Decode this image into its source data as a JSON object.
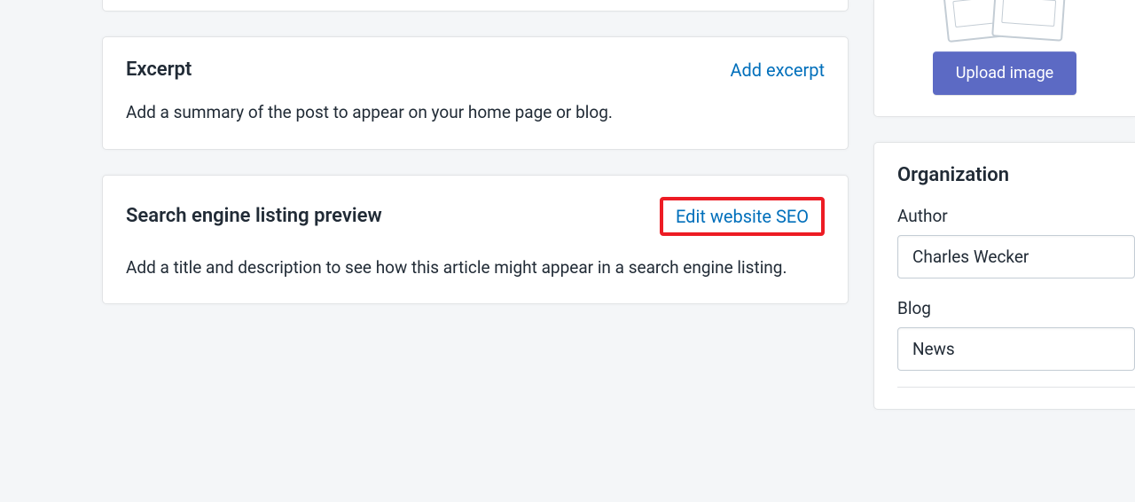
{
  "main": {
    "excerpt": {
      "title": "Excerpt",
      "action": "Add excerpt",
      "description": "Add a summary of the post to appear on your home page or blog."
    },
    "seo": {
      "title": "Search engine listing preview",
      "action": "Edit website SEO",
      "description": "Add a title and description to see how this article might appear in a search engine listing."
    }
  },
  "side": {
    "upload": {
      "button": "Upload image"
    },
    "organization": {
      "title": "Organization",
      "author": {
        "label": "Author",
        "value": "Charles Wecker"
      },
      "blog": {
        "label": "Blog",
        "value": "News"
      }
    }
  }
}
